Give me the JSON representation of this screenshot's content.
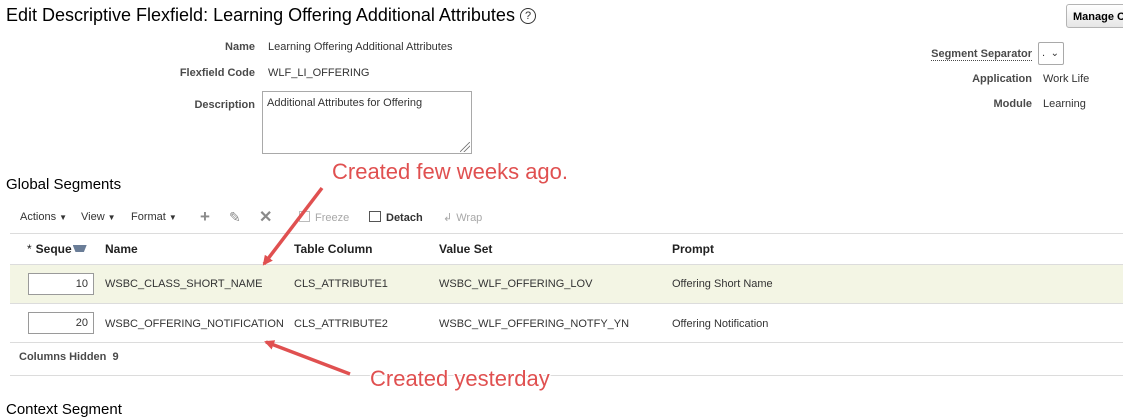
{
  "header": {
    "title": "Edit Descriptive Flexfield: Learning Offering Additional Attributes",
    "help_icon": "?",
    "manage_button": "Manage C"
  },
  "details": {
    "name_label": "Name",
    "name_value": "Learning Offering Additional Attributes",
    "code_label": "Flexfield Code",
    "code_value": "WLF_LI_OFFERING",
    "description_label": "Description",
    "description_value": "Additional Attributes for Offering",
    "separator_label": "Segment Separator",
    "separator_value": ".",
    "application_label": "Application",
    "application_value": "Work Life",
    "module_label": "Module",
    "module_value": "Learning"
  },
  "global_segments": {
    "title": "Global Segments",
    "toolbar": {
      "actions": "Actions",
      "view": "View",
      "format": "Format",
      "freeze": "Freeze",
      "detach": "Detach",
      "wrap": "Wrap"
    },
    "columns": {
      "required_marker": "*",
      "sequence": "Seque",
      "name": "Name",
      "table_column": "Table Column",
      "value_set": "Value Set",
      "prompt": "Prompt"
    },
    "rows": [
      {
        "sequence": "10",
        "name": "WSBC_CLASS_SHORT_NAME",
        "table_column": "CLS_ATTRIBUTE1",
        "value_set": "WSBC_WLF_OFFERING_LOV",
        "prompt": "Offering Short Name"
      },
      {
        "sequence": "20",
        "name": "WSBC_OFFERING_NOTIFICATION",
        "table_column": "CLS_ATTRIBUTE2",
        "value_set": "WSBC_WLF_OFFERING_NOTFY_YN",
        "prompt": "Offering Notification"
      }
    ],
    "columns_hidden_label": "Columns Hidden",
    "columns_hidden_count": "9"
  },
  "context_segment": {
    "title": "Context Segment"
  },
  "annotations": {
    "top_note": "Created few weeks ago.",
    "bottom_note": "Created yesterday",
    "color": "#e05050"
  },
  "colors": {
    "selected_row": "#f3f5e4",
    "grid_line": "#dcdcdc"
  }
}
